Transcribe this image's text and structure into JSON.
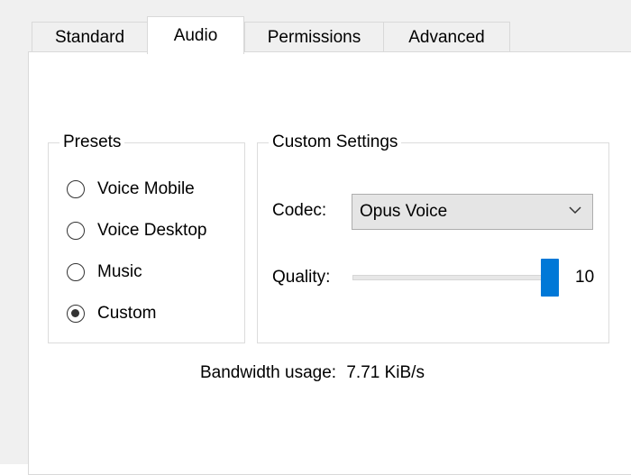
{
  "tabs": [
    {
      "label": "Standard"
    },
    {
      "label": "Audio",
      "active": true
    },
    {
      "label": "Permissions"
    },
    {
      "label": "Advanced"
    }
  ],
  "presets": {
    "title": "Presets",
    "options": [
      {
        "label": "Voice Mobile",
        "checked": false
      },
      {
        "label": "Voice Desktop",
        "checked": false
      },
      {
        "label": "Music",
        "checked": false
      },
      {
        "label": "Custom",
        "checked": true
      }
    ]
  },
  "custom": {
    "title": "Custom Settings",
    "codec_label": "Codec:",
    "codec_value": "Opus Voice",
    "quality_label": "Quality:",
    "quality_value": "10",
    "quality_level": 1.0
  },
  "bandwidth": {
    "label": "Bandwidth usage:",
    "value": "7.71 KiB/s"
  },
  "colors": {
    "accent": "#0078d7",
    "window_bg": "#f0f0f0",
    "panel_bg": "#ffffff"
  }
}
